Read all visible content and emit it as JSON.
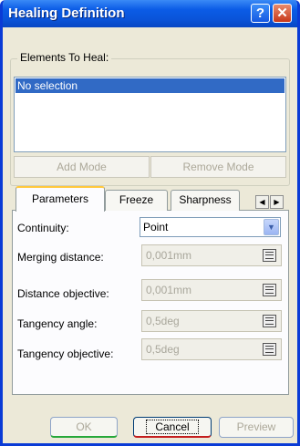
{
  "window": {
    "title": "Healing Definition",
    "help_glyph": "?",
    "close_glyph": "✕"
  },
  "elements_group": {
    "label": "Elements To Heal:",
    "selected_item": "No selection",
    "add_mode_label": "Add Mode",
    "remove_mode_label": "Remove Mode"
  },
  "tabs": [
    {
      "label": "Parameters",
      "active": true
    },
    {
      "label": "Freeze",
      "active": false
    },
    {
      "label": "Sharpness",
      "active": false
    }
  ],
  "tab_scroll": {
    "left_glyph": "◀",
    "right_glyph": "▶"
  },
  "parameters": {
    "continuity": {
      "label": "Continuity:",
      "value": "Point"
    },
    "merging_distance": {
      "label": "Merging distance:",
      "value": "0,001mm"
    },
    "distance_objective": {
      "label": "Distance objective:",
      "value": "0,001mm"
    },
    "tangency_angle": {
      "label": "Tangency angle:",
      "value": "0,5deg"
    },
    "tangency_objective": {
      "label": "Tangency objective:",
      "value": "0,5deg"
    }
  },
  "buttons": {
    "ok": "OK",
    "cancel": "Cancel",
    "preview": "Preview"
  },
  "colors": {
    "title_bar": "#0a54d9",
    "selection": "#316ac5",
    "window_bg": "#ece9d8"
  }
}
